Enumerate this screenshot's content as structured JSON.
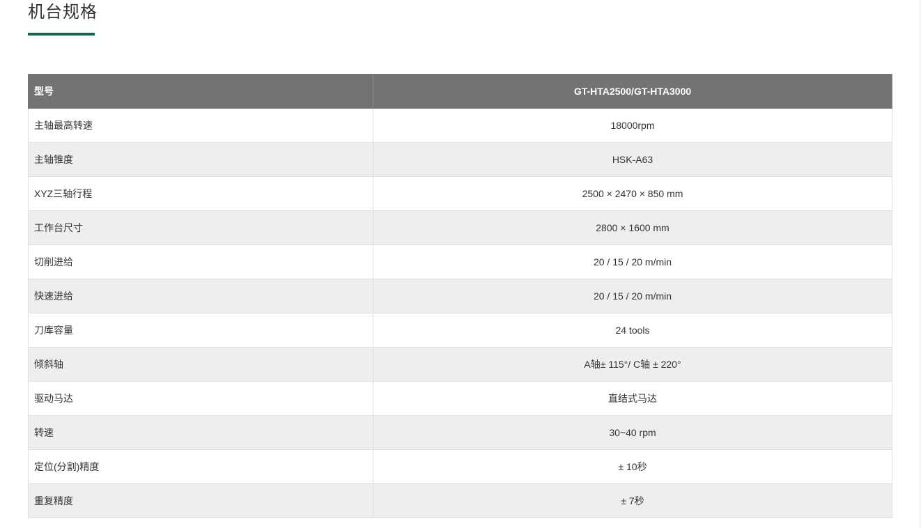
{
  "section": {
    "title": "机台规格"
  },
  "table": {
    "header": {
      "label": "型号",
      "value": "GT-HTA2500/GT-HTA3000"
    },
    "rows": [
      {
        "label": "主轴最高转速",
        "value": "18000rpm"
      },
      {
        "label": "主轴锥度",
        "value": "HSK-A63"
      },
      {
        "label": "XYZ三轴行程",
        "value": "2500 ×  2470 × 850 mm"
      },
      {
        "label": "工作台尺寸",
        "value": "2800 × 1600 mm"
      },
      {
        "label": "切削进给",
        "value": "20 / 15 / 20 m/min"
      },
      {
        "label": "快速进给",
        "value": "20 / 15 / 20 m/min"
      },
      {
        "label": "刀库容量",
        "value": "24 tools"
      },
      {
        "label": "倾斜轴",
        "value": "A轴± 115°/ C轴 ± 220°"
      },
      {
        "label": "驱动马达",
        "value": "直结式马达"
      },
      {
        "label": "转速",
        "value": "30~40 rpm"
      },
      {
        "label": "定位(分割)精度",
        "value": "± 10秒"
      },
      {
        "label": "重复精度",
        "value": "± 7秒"
      }
    ]
  },
  "colors": {
    "accent": "#0e6b45",
    "header_bg": "#737373",
    "row_alt_bg": "#eeeeee",
    "text": "#333333"
  }
}
